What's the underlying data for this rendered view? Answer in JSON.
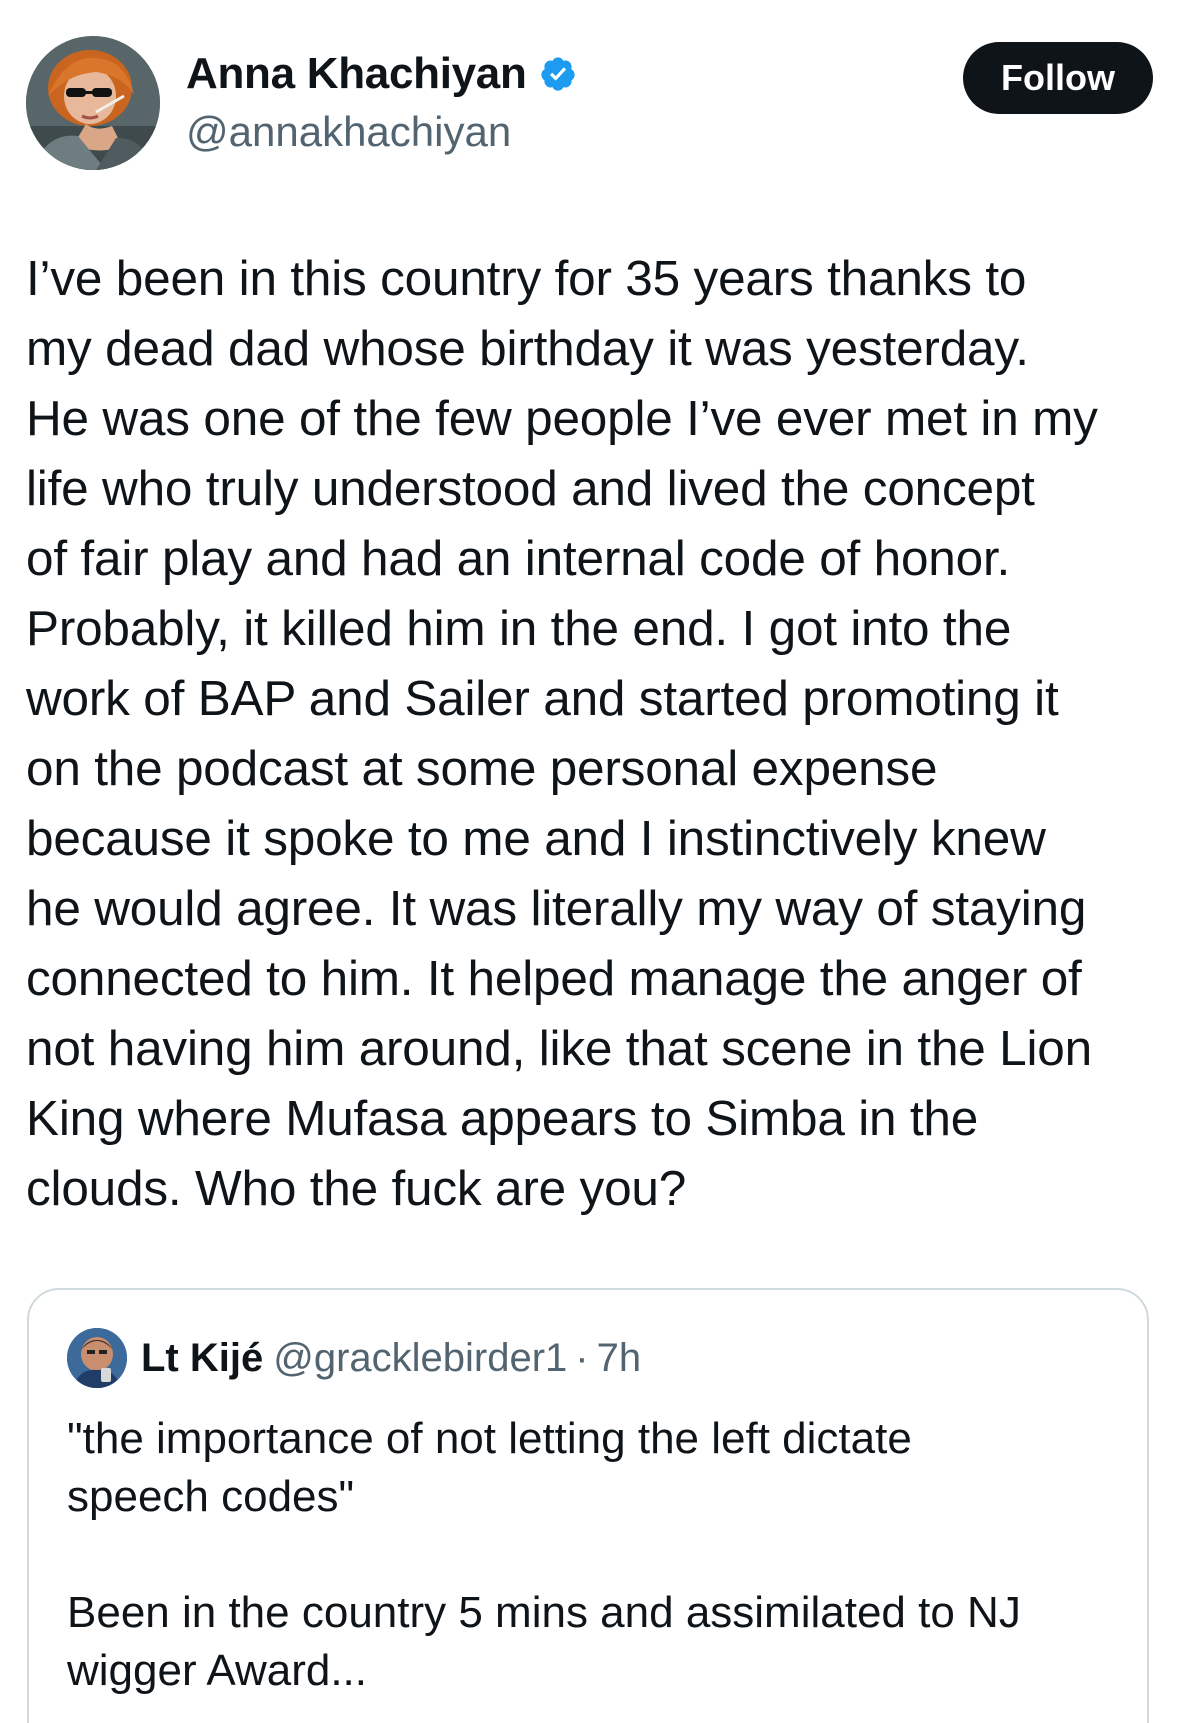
{
  "author": {
    "display_name": "Anna Khachiyan",
    "handle": "@annakhachiyan",
    "verified": true,
    "avatar_icon": "profile-photo",
    "verified_icon": "verified-badge-icon"
  },
  "follow_button": {
    "label": "Follow"
  },
  "tweet": {
    "text": "I’ve been in this country for 35 years thanks to\nmy dead dad whose birthday it was yesterday.\nHe was one of the few people I’ve ever met in my\nlife who truly understood and lived the concept\nof fair play and had an internal code of honor.\nProbably, it killed him in the end. I got into the\nwork of BAP and Sailer and started promoting it\non the podcast at some personal expense\nbecause it spoke to me and I instinctively knew\nhe would agree. It was literally my way of staying\nconnected to him. It helped manage the anger of\nnot having him around, like that scene in the Lion\nKing where Mufasa appears to Simba in the\nclouds. Who the fuck are you?"
  },
  "quoted_tweet": {
    "display_name": "Lt Kijé",
    "handle": "@gracklebirder1",
    "separator": "·",
    "time": "7h",
    "text": "\"the importance of not letting the left dictate\nspeech codes\"\n\nBeen in the country 5 mins and assimilated to NJ\nwigger Award..."
  },
  "colors": {
    "text_primary": "#0f1419",
    "text_secondary": "#536471",
    "verified_blue": "#1d9bf0",
    "border": "#cfd9de",
    "follow_bg": "#0f1419"
  }
}
